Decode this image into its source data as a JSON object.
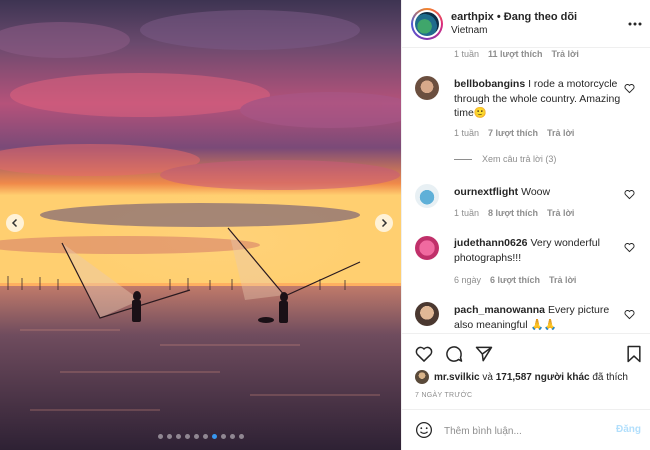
{
  "post": {
    "username": "earthpix",
    "separator": "•",
    "follow_status": "Đang theo dõi",
    "location": "Vietnam"
  },
  "carousel": {
    "slides": 10,
    "active_index": 6
  },
  "comments": {
    "partial_meta": {
      "time": "1 tuần",
      "likes": "11 lượt thích",
      "reply": "Trả lời"
    },
    "items": [
      {
        "user": "bellbobangins",
        "text": "I rode a motorcycle through the whole country. Amazing time🙂",
        "time": "1 tuần",
        "likes": "7 lượt thích",
        "reply": "Trả lời",
        "view_replies": "Xem câu trả lời (3)"
      },
      {
        "user": "ournextflight",
        "text": "Woow",
        "time": "1 tuần",
        "likes": "8 lượt thích",
        "reply": "Trả lời"
      },
      {
        "user": "judethann0626",
        "text": "Very wonderful photographs!!!",
        "time": "6 ngày",
        "likes": "6 lượt thích",
        "reply": "Trả lời"
      },
      {
        "user": "pach_manowanna",
        "text": "Every picture also meaningful 🙏🙏"
      }
    ]
  },
  "likes": {
    "first_user": "mr.svilkic",
    "connector": "và",
    "others": "171,587 người khác",
    "suffix": "đã thích"
  },
  "date": "7 NGÀY TRƯỚC",
  "add_comment": {
    "placeholder": "Thêm bình luận...",
    "post_label": "Đăng"
  },
  "colors": {
    "accent": "#3897f0",
    "post_disabled": "#b2dffc",
    "muted": "#8e8e8e"
  }
}
